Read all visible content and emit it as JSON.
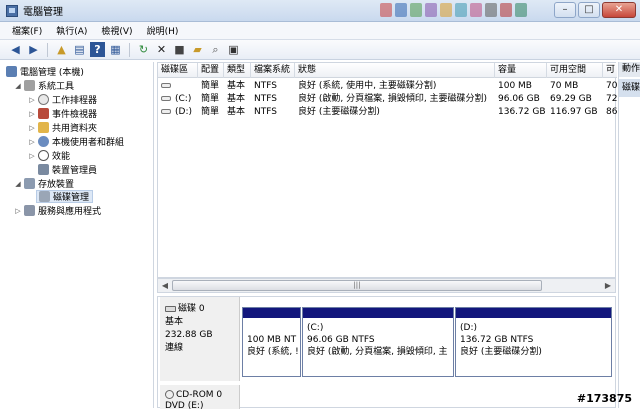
{
  "window": {
    "title": "電腦管理"
  },
  "menu": [
    "檔案(F)",
    "執行(A)",
    "檢視(V)",
    "說明(H)"
  ],
  "toolbar_icons": [
    "back-icon",
    "forward-icon",
    "up-folder-icon",
    "show-hide-tree-icon",
    "help-icon",
    "properties-panel-icon",
    "refresh-icon",
    "delete-icon",
    "properties-icon",
    "open-icon",
    "search-icon",
    "export-icon"
  ],
  "tree": {
    "root": "電腦管理 (本機)",
    "system_tools": "系統工具",
    "task_scheduler": "工作排程器",
    "event_viewer": "事件檢視器",
    "shared_folders": "共用資料夾",
    "local_users": "本機使用者和群組",
    "performance": "效能",
    "device_manager": "裝置管理員",
    "storage": "存放裝置",
    "disk_management": "磁碟管理",
    "services": "服務與應用程式"
  },
  "volumes": {
    "columns": [
      "磁碟區",
      "配置",
      "類型",
      "檔案系統",
      "狀態",
      "容量",
      "可用空間",
      "可"
    ],
    "rows": [
      {
        "name": "",
        "layout": "簡單",
        "type": "基本",
        "fs": "NTFS",
        "status": "良好 (系統, 使用中, 主要磁碟分割)",
        "capacity": "100 MB",
        "free": "70 MB",
        "pct": "70"
      },
      {
        "name": "(C:)",
        "layout": "簡單",
        "type": "基本",
        "fs": "NTFS",
        "status": "良好 (啟動, 分頁檔案, 損毀傾印, 主要磁碟分割)",
        "capacity": "96.06 GB",
        "free": "69.29 GB",
        "pct": "72"
      },
      {
        "name": "(D:)",
        "layout": "簡單",
        "type": "基本",
        "fs": "NTFS",
        "status": "良好 (主要磁碟分割)",
        "capacity": "136.72 GB",
        "free": "116.97 GB",
        "pct": "86"
      }
    ]
  },
  "scrollbar": {
    "grip": "|||"
  },
  "disk0": {
    "name": "磁碟 0",
    "type": "基本",
    "size": "232.88 GB",
    "state": "連線",
    "partitions": [
      {
        "line1": "",
        "line2": "100 MB NT",
        "line3": "良好 (系統, !"
      },
      {
        "line1": "(C:)",
        "line2": "96.06 GB NTFS",
        "line3": "良好 (啟動, 分頁檔案, 損毀傾印, 主"
      },
      {
        "line1": "(D:)",
        "line2": "136.72 GB NTFS",
        "line3": "良好 (主要磁碟分割)"
      }
    ]
  },
  "cdrom": {
    "name": "CD-ROM 0",
    "drive": "DVD (E:)"
  },
  "actions": {
    "header": "動作",
    "item": "磁碟"
  },
  "watermark": "#173875"
}
